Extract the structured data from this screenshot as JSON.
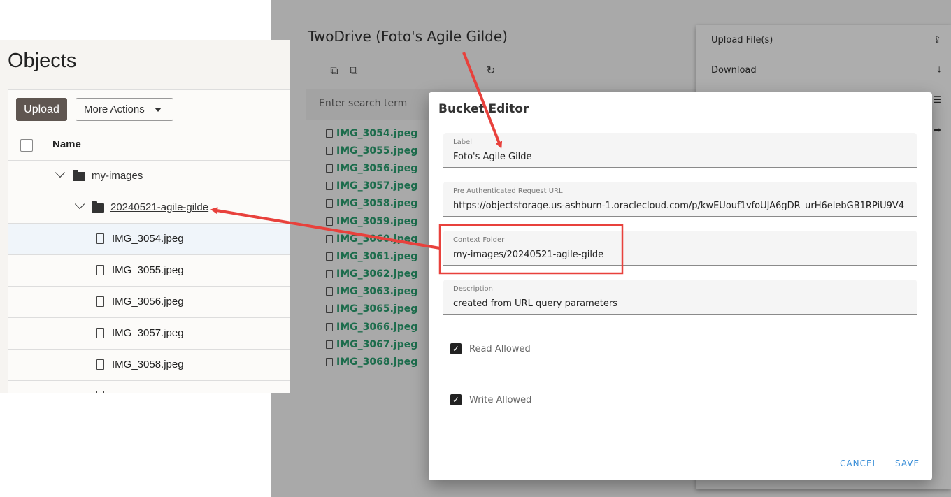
{
  "app": {
    "title": "TwoDrive (Foto's Agile Gilde)",
    "search_placeholder": "Enter search term",
    "files": [
      "IMG_3054.jpeg",
      "IMG_3055.jpeg",
      "IMG_3056.jpeg",
      "IMG_3057.jpeg",
      "IMG_3058.jpeg",
      "IMG_3059.jpeg",
      "IMG_3060.jpeg",
      "IMG_3061.jpeg",
      "IMG_3062.jpeg",
      "IMG_3063.jpeg",
      "IMG_3065.jpeg",
      "IMG_3066.jpeg",
      "IMG_3067.jpeg",
      "IMG_3068.jpeg"
    ],
    "menu": {
      "upload_label": "Upload File(s)",
      "download_label": "Download"
    }
  },
  "dialog": {
    "title": "Bucket Editor",
    "label_field": {
      "label": "Label",
      "value": "Foto's Agile Gilde"
    },
    "par_field": {
      "label": "Pre Authenticated Request URL",
      "value": "https://objectstorage.us-ashburn-1.oraclecloud.com/p/kwEUouf1vfoUJA6gDR_urH6elebGB1RPiU9V4"
    },
    "context_field": {
      "label": "Context Folder",
      "value": "my-images/20240521-agile-gilde"
    },
    "description_field": {
      "label": "Description",
      "value": "created from URL query parameters"
    },
    "read_allowed": {
      "label": "Read Allowed",
      "checked": true
    },
    "write_allowed": {
      "label": "Write Allowed",
      "checked": true
    },
    "cancel_label": "CANCEL",
    "save_label": "SAVE"
  },
  "oci": {
    "title": "Objects",
    "upload_label": "Upload",
    "more_actions_label": "More Actions",
    "name_header": "Name",
    "folder1": "my-images",
    "folder2": "20240521-agile-gilde",
    "files": [
      "IMG_3054.jpeg",
      "IMG_3055.jpeg",
      "IMG_3056.jpeg",
      "IMG_3057.jpeg",
      "IMG_3058.jpeg"
    ]
  },
  "colors": {
    "annotation_red": "#e8413c",
    "file_link_green": "#2aa070",
    "dialog_action_blue": "#3b8fd8"
  }
}
